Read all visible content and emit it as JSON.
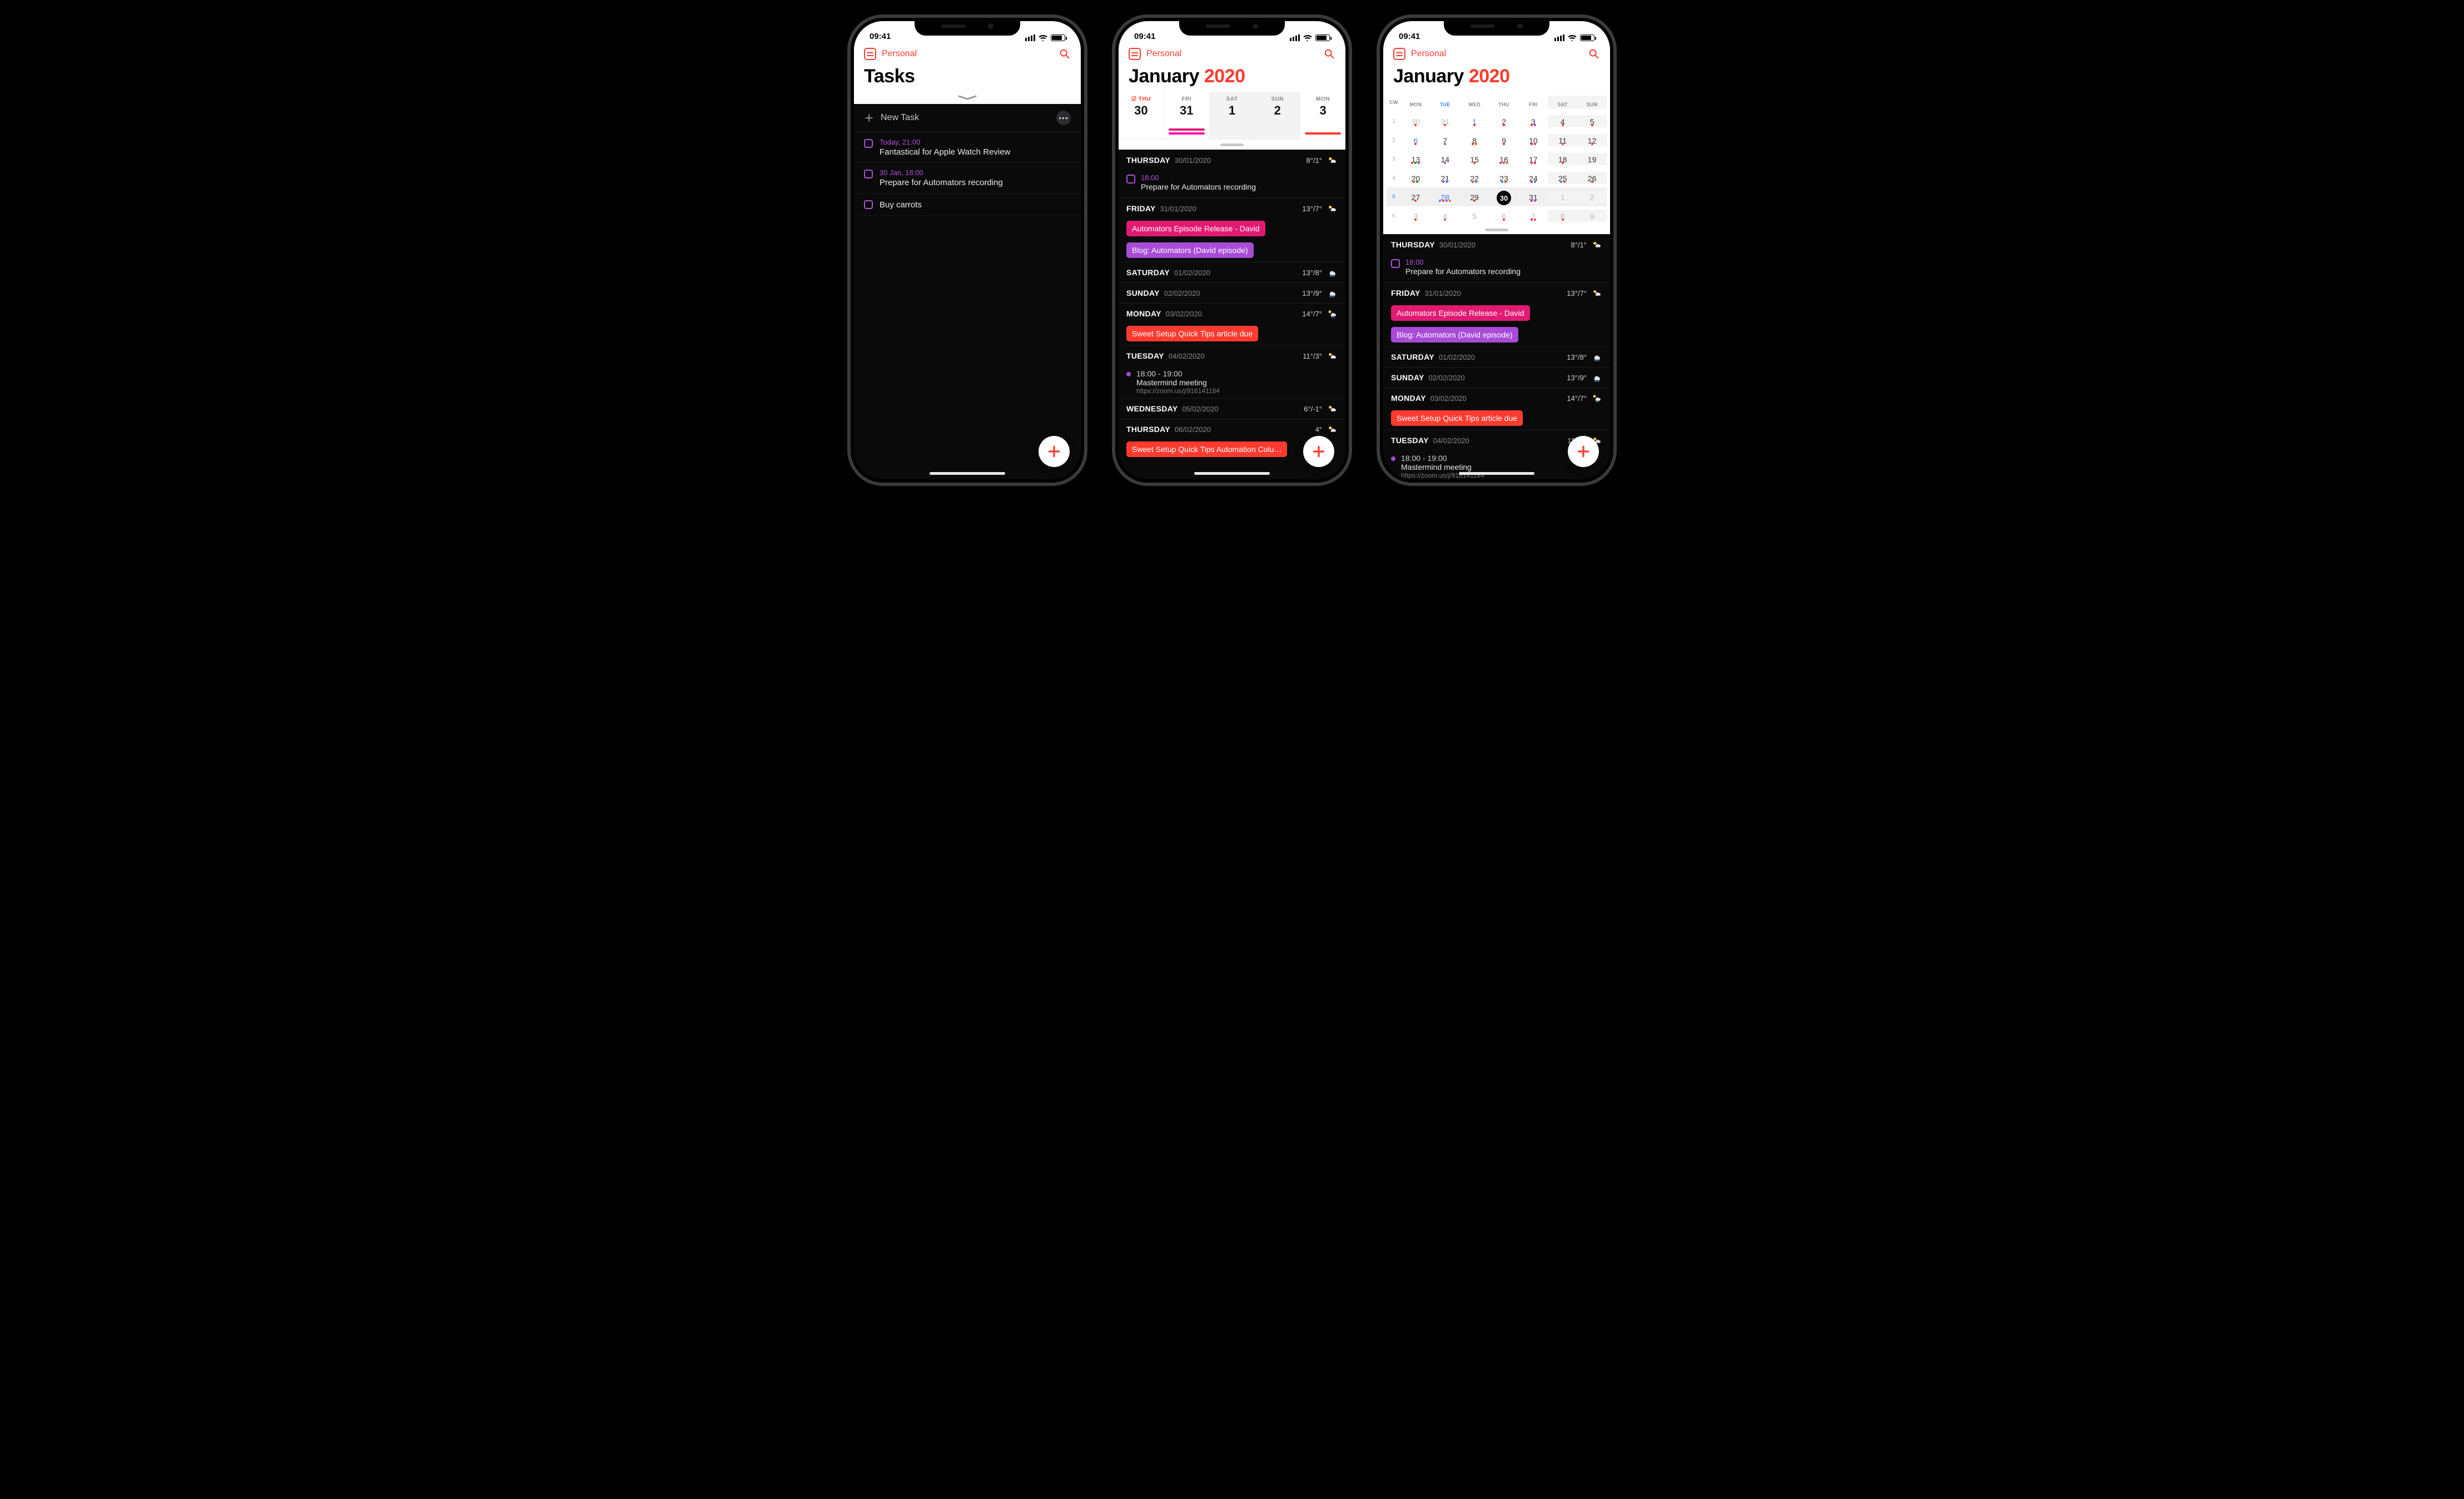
{
  "status": {
    "time": "09:41"
  },
  "app": {
    "calendar_set": "Personal"
  },
  "colors": {
    "red": "#ff3b30",
    "purple": "#af52de",
    "pink": "#e11a73",
    "violet": "#a84bd6",
    "orange": "#ff6a00",
    "magenta": "#ff00aa",
    "blue": "#3b82f6"
  },
  "p1": {
    "title": "Tasks",
    "new_task": "New Task",
    "tasks": [
      {
        "meta": "Today, 21:00",
        "text": "Fantastical for Apple Watch Review"
      },
      {
        "meta": "30 Jan, 18:00",
        "text": "Prepare for Automators recording"
      },
      {
        "meta": "",
        "text": "Buy carrots"
      }
    ]
  },
  "p2": {
    "title_month": "January",
    "title_year": "2020",
    "strip": [
      {
        "lbl": "☑ THU",
        "num": "30",
        "sel": true,
        "bars": []
      },
      {
        "lbl": "FRI",
        "num": "31",
        "bars": [
          "#e11a73",
          "#ff00aa"
        ]
      },
      {
        "lbl": "SAT",
        "num": "1",
        "wknd": true,
        "bars": []
      },
      {
        "lbl": "SUN",
        "num": "2",
        "wknd": true,
        "bars": []
      },
      {
        "lbl": "MON",
        "num": "3",
        "bars": [
          "#ff3b30"
        ]
      }
    ],
    "days": [
      {
        "wd": "THURSDAY",
        "dt": "30/01/2020",
        "temp": "8°/1°",
        "icon": "partly",
        "items": [
          {
            "type": "task",
            "time": "18:00",
            "text": "Prepare for Automators recording"
          }
        ]
      },
      {
        "wd": "FRIDAY",
        "dt": "31/01/2020",
        "temp": "13°/7°",
        "icon": "partly",
        "items": [
          {
            "type": "pill",
            "color": "#e11a73",
            "text": "Automators Episode Release - David"
          },
          {
            "type": "pill",
            "color": "#a84bd6",
            "text": "Blog: Automators (David episode)"
          }
        ]
      },
      {
        "wd": "SATURDAY",
        "dt": "01/02/2020",
        "temp": "13°/8°",
        "icon": "rain",
        "items": []
      },
      {
        "wd": "SUNDAY",
        "dt": "02/02/2020",
        "temp": "13°/9°",
        "icon": "rain",
        "items": []
      },
      {
        "wd": "MONDAY",
        "dt": "03/02/2020",
        "temp": "14°/7°",
        "icon": "rainsun",
        "items": [
          {
            "type": "pill",
            "color": "#ff3b30",
            "text": "Sweet Setup Quick Tips article due"
          }
        ]
      },
      {
        "wd": "TUESDAY",
        "dt": "04/02/2020",
        "temp": "11°/3°",
        "icon": "partly",
        "items": [
          {
            "type": "dot",
            "color": "#a84bd6",
            "time": "18:00 - 19:00",
            "text": "Mastermind meeting",
            "link": "https://zoom.us/j/916141184"
          }
        ]
      },
      {
        "wd": "WEDNESDAY",
        "dt": "05/02/2020",
        "temp": "6°/-1°",
        "icon": "partly",
        "items": []
      },
      {
        "wd": "THURSDAY",
        "dt": "06/02/2020",
        "temp": "4°",
        "icon": "partly",
        "items": [
          {
            "type": "pill",
            "color": "#ff3b30",
            "text": "Sweet Setup Quick Tips Automation Colu…"
          }
        ]
      }
    ]
  },
  "p3": {
    "title_month": "January",
    "title_year": "2020",
    "header": [
      "CW",
      "MON",
      "TUE",
      "WED",
      "THU",
      "FRI",
      "SAT",
      "SUN"
    ],
    "rows": [
      {
        "cw": "1",
        "cells": [
          {
            "n": "30",
            "fade": true,
            "d": [
              "#ff3b30"
            ]
          },
          {
            "n": "31",
            "fade": true,
            "d": [
              "#ff3b30"
            ]
          },
          {
            "n": "1",
            "hol": true,
            "d": [
              "#ff3b30"
            ]
          },
          {
            "n": "2",
            "d": [
              "#ff3b30"
            ]
          },
          {
            "n": "3",
            "d": [
              "#ff3b30",
              "#a84bd6"
            ]
          },
          {
            "n": "4",
            "wknd": true,
            "d": [
              "#ff3b30"
            ]
          },
          {
            "n": "5",
            "wknd": true,
            "d": [
              "#ff3b30"
            ]
          }
        ]
      },
      {
        "cw": "2",
        "cells": [
          {
            "n": "6",
            "hol": true,
            "d": [
              "#ff3b30"
            ]
          },
          {
            "n": "7",
            "d": [
              "#a84bd6"
            ]
          },
          {
            "n": "8",
            "d": [
              "#ff3b30",
              "#ff6a00"
            ]
          },
          {
            "n": "9",
            "d": [
              "#ff3b30"
            ]
          },
          {
            "n": "10",
            "d": [
              "#e11a73",
              "#ff3b30"
            ]
          },
          {
            "n": "11",
            "wknd": true,
            "d": [
              "#ff3b30"
            ]
          },
          {
            "n": "12",
            "wknd": true,
            "d": [
              "#ff3b30"
            ]
          }
        ]
      },
      {
        "cw": "3",
        "cells": [
          {
            "n": "13",
            "d": [
              "#ff3b30",
              "#00a000",
              "#a84bd6"
            ]
          },
          {
            "n": "14",
            "d": [
              "#a84bd6"
            ]
          },
          {
            "n": "15",
            "d": [
              "#ff3b30"
            ]
          },
          {
            "n": "16",
            "d": [
              "#ff3b30",
              "#a84bd6",
              "#ff6a00"
            ]
          },
          {
            "n": "17",
            "d": [
              "#ff3b30",
              "#e11a73"
            ]
          },
          {
            "n": "18",
            "wknd": true,
            "d": [
              "#ff3b30"
            ]
          },
          {
            "n": "19",
            "wknd": true,
            "d": []
          }
        ]
      },
      {
        "cw": "4",
        "cells": [
          {
            "n": "20",
            "d": [
              "#ff3b30",
              "#00a000"
            ]
          },
          {
            "n": "21",
            "d": [
              "#a84bd6",
              "#3b82f6"
            ]
          },
          {
            "n": "22",
            "d": [
              "#ff3b30",
              "#3b82f6"
            ]
          },
          {
            "n": "23",
            "d": [
              "#3b82f6",
              "#ff3b30"
            ]
          },
          {
            "n": "24",
            "d": [
              "#e11a73",
              "#3b82f6"
            ]
          },
          {
            "n": "25",
            "wknd": true,
            "d": [
              "#3b82f6",
              "#ff3b30"
            ]
          },
          {
            "n": "26",
            "wknd": true,
            "d": [
              "#ff3b30"
            ]
          }
        ]
      },
      {
        "cw": "5",
        "hi": true,
        "cells": [
          {
            "n": "27",
            "d": [
              "#ff3b30"
            ]
          },
          {
            "n": "28",
            "hol": true,
            "d": [
              "#3b82f6",
              "#ff3b30",
              "#a84bd6",
              "#ff6a00"
            ]
          },
          {
            "n": "29",
            "d": [
              "#ff3b30"
            ]
          },
          {
            "n": "30",
            "today": true,
            "d": []
          },
          {
            "n": "31",
            "d": [
              "#e11a73",
              "#a84bd6"
            ]
          },
          {
            "n": "1",
            "wknd": true,
            "fade": true,
            "d": []
          },
          {
            "n": "2",
            "wknd": true,
            "fade": true,
            "d": []
          }
        ]
      },
      {
        "cw": "6",
        "cells": [
          {
            "n": "3",
            "fade": true,
            "d": [
              "#ff3b30"
            ]
          },
          {
            "n": "4",
            "fade": true,
            "d": [
              "#a84bd6"
            ]
          },
          {
            "n": "5",
            "fade": true,
            "d": []
          },
          {
            "n": "6",
            "fade": true,
            "d": [
              "#ff3b30"
            ]
          },
          {
            "n": "7",
            "fade": true,
            "d": [
              "#e11a73",
              "#ff3b30"
            ]
          },
          {
            "n": "8",
            "wknd": true,
            "fade": true,
            "d": [
              "#ff3b30"
            ]
          },
          {
            "n": "9",
            "wknd": true,
            "fade": true,
            "d": []
          }
        ]
      }
    ],
    "days": [
      {
        "wd": "THURSDAY",
        "dt": "30/01/2020",
        "temp": "8°/1°",
        "icon": "partly",
        "items": [
          {
            "type": "task",
            "time": "18:00",
            "text": "Prepare for Automators recording"
          }
        ]
      },
      {
        "wd": "FRIDAY",
        "dt": "31/01/2020",
        "temp": "13°/7°",
        "icon": "partly",
        "items": [
          {
            "type": "pill",
            "color": "#e11a73",
            "text": "Automators Episode Release - David"
          },
          {
            "type": "pill",
            "color": "#a84bd6",
            "text": "Blog: Automators (David episode)"
          }
        ]
      },
      {
        "wd": "SATURDAY",
        "dt": "01/02/2020",
        "temp": "13°/8°",
        "icon": "rain",
        "items": []
      },
      {
        "wd": "SUNDAY",
        "dt": "02/02/2020",
        "temp": "13°/9°",
        "icon": "rain",
        "items": []
      },
      {
        "wd": "MONDAY",
        "dt": "03/02/2020",
        "temp": "14°/7°",
        "icon": "rainsun",
        "items": [
          {
            "type": "pill",
            "color": "#ff3b30",
            "text": "Sweet Setup Quick Tips article due"
          }
        ]
      },
      {
        "wd": "TUESDAY",
        "dt": "04/02/2020",
        "temp": "11°/3°",
        "icon": "partly",
        "items": [
          {
            "type": "dot",
            "color": "#a84bd6",
            "time": "18:00 - 19:00",
            "text": "Mastermind meeting",
            "link": "https://zoom.us/j/916141184"
          }
        ]
      }
    ]
  }
}
